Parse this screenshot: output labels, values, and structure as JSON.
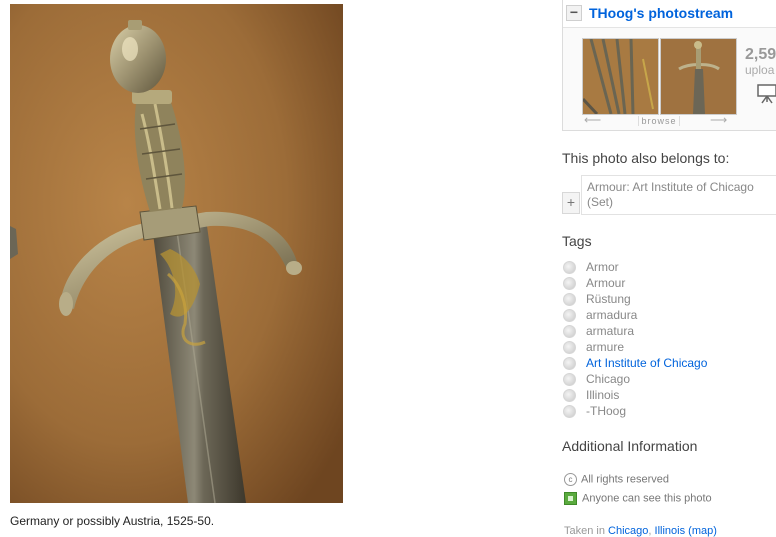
{
  "photo": {
    "caption": "Germany or possibly Austria, 1525-50."
  },
  "photostream": {
    "collapse_symbol": "−",
    "title": "THoog's photostream",
    "uploads_count": "2,59",
    "uploads_label": "uploa",
    "browse_label": "browse",
    "prev_icon": "arrow-left-icon",
    "next_icon": "arrow-right-icon"
  },
  "sets": {
    "heading": "This photo also belongs to:",
    "add_symbol": "+",
    "items": [
      {
        "title": "Armour: Art Institute of Chicago (Set)"
      }
    ]
  },
  "tags": {
    "heading": "Tags",
    "items": [
      {
        "label": "Armor",
        "link": false
      },
      {
        "label": "Armour",
        "link": false
      },
      {
        "label": "Rüstung",
        "link": false
      },
      {
        "label": "armadura",
        "link": false
      },
      {
        "label": "armatura",
        "link": false
      },
      {
        "label": "armure",
        "link": false
      },
      {
        "label": "Art Institute of Chicago",
        "link": true
      },
      {
        "label": "Chicago",
        "link": false
      },
      {
        "label": "Illinois",
        "link": false
      },
      {
        "label": "-THoog",
        "link": false
      }
    ]
  },
  "additional_info": {
    "heading": "Additional Information",
    "rights_icon_text": "c",
    "rights": "All rights reserved",
    "visibility": "Anyone can see this photo",
    "taken_prefix": "Taken in",
    "taken_city": "Chicago",
    "taken_state": "Illinois",
    "taken_map": "(map)"
  },
  "colors": {
    "link": "#0063dc",
    "background_wall": "#9a6a36",
    "visibility_green": "#5aaa3e"
  }
}
